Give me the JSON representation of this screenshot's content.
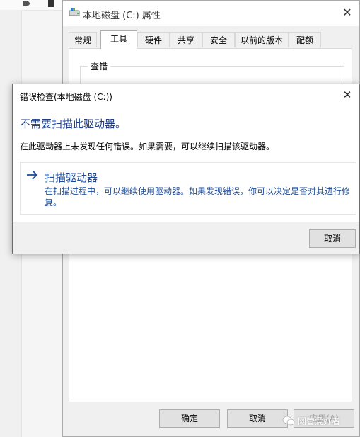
{
  "properties": {
    "title": "本地磁盘 (C:) 属性",
    "tabs": [
      "常规",
      "工具",
      "硬件",
      "共享",
      "安全",
      "以前的版本",
      "配额"
    ],
    "active_tab": "工具",
    "group_label": "查错",
    "buttons": {
      "ok": "确定",
      "cancel": "取消",
      "apply": "应用(A)"
    }
  },
  "dialog": {
    "title": "错误检查(本地磁盘 (C:))",
    "heading": "不需要扫描此驱动器。",
    "message": "在此驱动器上未发现任何错误。如果需要，可以继续扫描该驱动器。",
    "scan_title": "扫描驱动器",
    "scan_description": "在扫描过程中，可以继续使用驱动器。如果发现错误，你可以决定是否对其进行修复。",
    "cancel": "取消"
  },
  "watermark": {
    "text": "网管爱好者"
  },
  "colors": {
    "heading": "#1e3e8c",
    "link": "#1a4a9a",
    "window_bg": "#f0f0f0"
  }
}
